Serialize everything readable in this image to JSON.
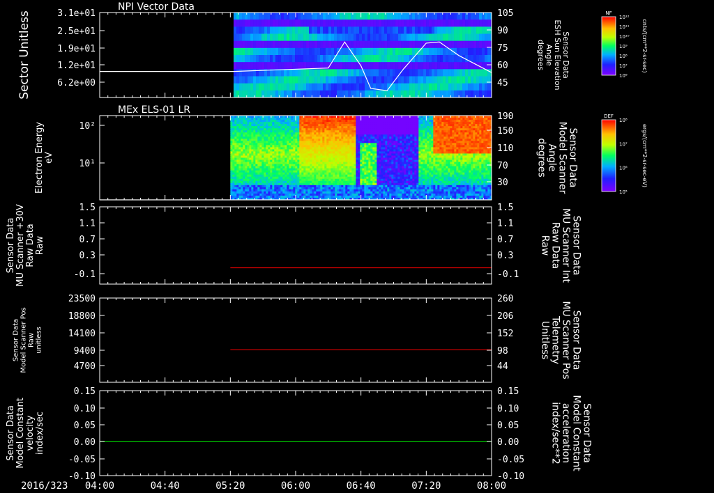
{
  "chart_data": [
    {
      "type": "heatmap",
      "title": "NPI Vector Data",
      "ylabel": "Sector Unitless",
      "yticks": [
        "3.1e+01",
        "2.5e+01",
        "1.9e+01",
        "1.2e+01",
        "6.2e+00"
      ],
      "y2label": [
        "Sensor Data",
        "ESH Sun Elevation",
        "Angle",
        "degrees"
      ],
      "y2ticks": [
        "105",
        "90",
        "75",
        "60",
        "45"
      ],
      "ylim2": [
        30,
        105
      ],
      "data_start": "05:22",
      "line": {
        "name": "ESH Sun Elevation Angle",
        "color": "#ffffff",
        "x": [
          "04:00",
          "05:22",
          "06:20",
          "06:30",
          "06:40",
          "06:46",
          "06:56",
          "07:06",
          "07:20",
          "07:28",
          "07:40",
          "08:00"
        ],
        "y": [
          53,
          53,
          56,
          79,
          58,
          38,
          36,
          55,
          78,
          79,
          67,
          52
        ]
      },
      "colorbar": {
        "title": "NF",
        "ticks": [
          "10¹²",
          "10¹¹",
          "10¹⁰",
          "10⁹",
          "10⁸",
          "10⁷",
          "10⁶"
        ],
        "unit": "cnts/(cm**2-sr-sec)"
      }
    },
    {
      "type": "heatmap",
      "title": "MEx ELS-01 LR",
      "ylabel": [
        "Electron Energy",
        "eV"
      ],
      "yticks": [
        "10²",
        "10¹"
      ],
      "y2label": [
        "Sensor Data",
        "Model Scanner",
        "Angle",
        "degrees"
      ],
      "y2ticks": [
        "190",
        "150",
        "110",
        "70",
        "30"
      ],
      "ylim2": [
        10,
        190
      ],
      "data_start": "05:20",
      "line": {
        "name": "Model Scanner Angle",
        "color": "#ffffff",
        "x": [
          "04:00",
          "08:00"
        ],
        "y": [
          10,
          10
        ]
      },
      "colorbar": {
        "title": "DEF",
        "ticks": [
          "10⁸",
          "10⁷",
          "10⁶",
          "10⁵"
        ],
        "unit": "ergs/(cm**2-sr-sec-eV)"
      }
    },
    {
      "type": "line",
      "ylabel": [
        "Sensor Data",
        "MU Scanner +30V",
        "Raw Data",
        "Raw"
      ],
      "yticks": [
        "1.5",
        "1.1",
        "0.7",
        "0.3",
        "-0.1"
      ],
      "y2label": [
        "Sensor Data",
        "MU Scanner Int",
        "Raw Data",
        "Raw"
      ],
      "y2ticks": [
        "1.5",
        "1.1",
        "0.7",
        "0.3",
        "-0.1"
      ],
      "ylim": [
        -0.4,
        1.5
      ],
      "series": [
        {
          "name": "MU Scanner Int Raw Data",
          "color": "#ff0000",
          "x": [
            "05:20",
            "08:00"
          ],
          "y": [
            0,
            0
          ]
        }
      ]
    },
    {
      "type": "line",
      "ylabel": [
        "Sensor Data",
        "Model Scanner Pos",
        "Raw",
        "unitless"
      ],
      "yticks": [
        "23500",
        "18800",
        "14100",
        "9400",
        "4700"
      ],
      "y2label": [
        "Sensor Data",
        "MU Scanner Pos",
        "Telemetry",
        "Unitless"
      ],
      "y2ticks": [
        "260",
        "206",
        "152",
        "98",
        "44"
      ],
      "ylim2": [
        -4,
        260
      ],
      "series": [
        {
          "name": "MU Scanner Pos Telemetry",
          "color": "#ff0000",
          "x": [
            "05:20",
            "08:00"
          ],
          "y": [
            98,
            98
          ]
        }
      ]
    },
    {
      "type": "line",
      "ylabel": [
        "Sensor Data",
        "Model Constant",
        "velocity",
        "index/sec"
      ],
      "yticks": [
        "0.15",
        "0.10",
        "0.05",
        "0.00",
        "-0.05",
        "-0.10"
      ],
      "y2label": [
        "Sensor Data",
        "Model Constant",
        "acceleration",
        "index/sec**2"
      ],
      "y2ticks": [
        "0.15",
        "0.10",
        "0.05",
        "0.00",
        "-0.05",
        "-0.10"
      ],
      "ylim": [
        -0.1,
        0.15
      ],
      "series": [
        {
          "name": "Model Constant acceleration",
          "color": "#00ff00",
          "x": [
            "04:00",
            "08:00"
          ],
          "y": [
            0,
            0
          ]
        }
      ]
    }
  ],
  "xaxis": {
    "date": "2016/323",
    "ticks": [
      "04:00",
      "04:40",
      "05:20",
      "06:00",
      "06:40",
      "07:20",
      "08:00"
    ],
    "range": [
      "04:00",
      "08:00"
    ]
  },
  "colors": {
    "background": "#000000",
    "axis": "#ffffff",
    "y2_red": "#ff0000",
    "y2_green": "#00ff00"
  }
}
